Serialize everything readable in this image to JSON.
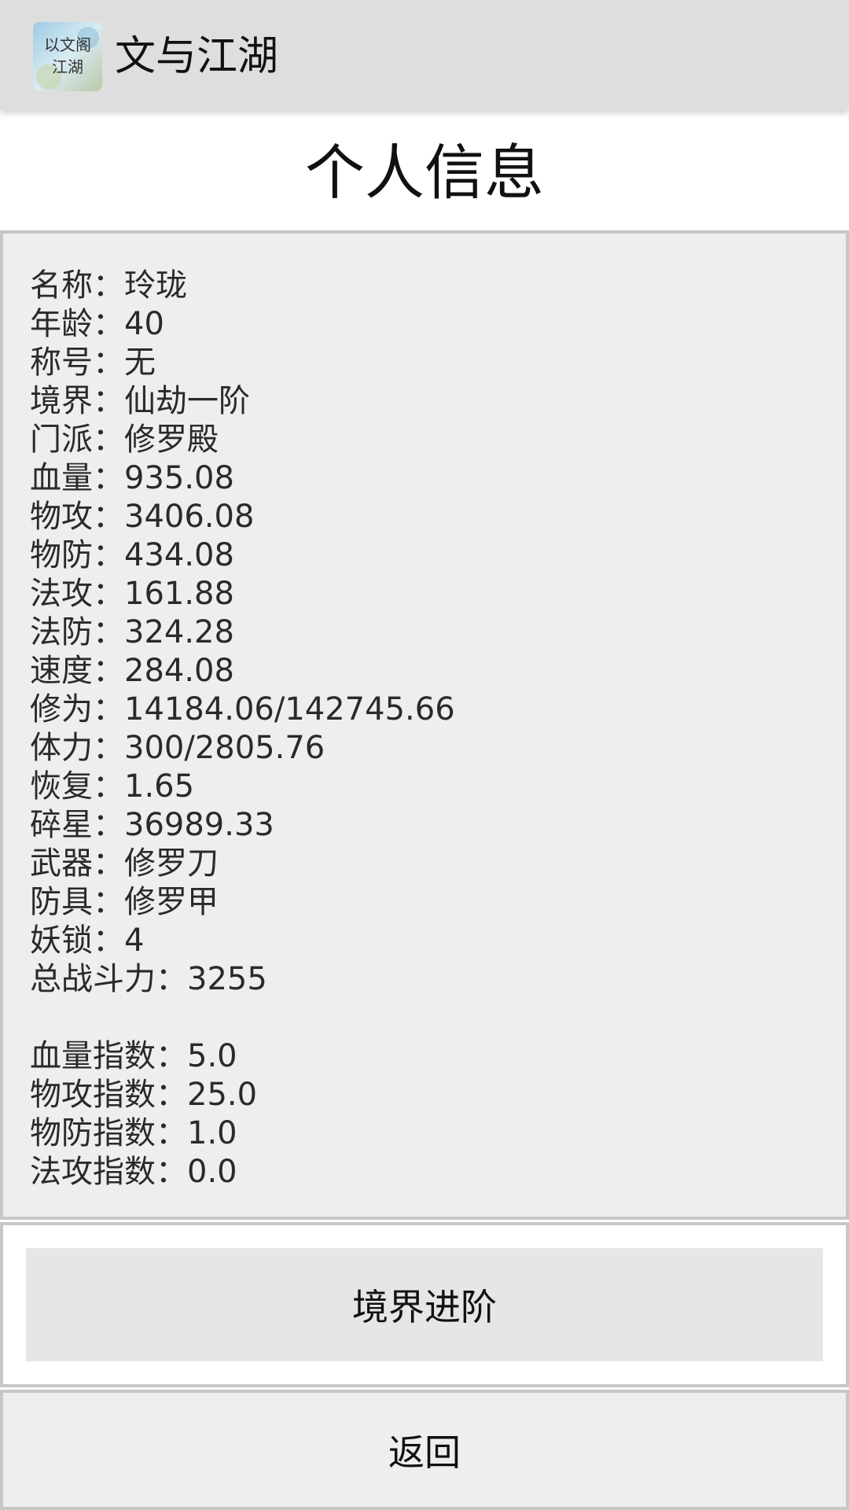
{
  "appbar": {
    "title": "文与江湖",
    "icon": "app-logo-icon"
  },
  "page_title": "个人信息",
  "info_lines": [
    "名称：玲珑",
    "年龄：40",
    "称号：无",
    "境界：仙劫一阶",
    "门派：修罗殿",
    "血量：935.08",
    "物攻：3406.08",
    "物防：434.08",
    "法攻：161.88",
    "法防：324.28",
    "速度：284.08",
    "修为：14184.06/142745.66",
    "体力：300/2805.76",
    "恢复：1.65",
    "碎星：36989.33",
    "武器：修罗刀",
    "防具：修罗甲",
    "妖锁：4",
    "总战斗力：3255"
  ],
  "index_lines": [
    "血量指数：5.0",
    "物攻指数：25.0",
    "物防指数：1.0",
    "法攻指数：0.0"
  ],
  "buttons": {
    "advance_label": "境界进阶",
    "back_label": "返回"
  },
  "colors": {
    "appbar_bg": "#dedede",
    "panel_bg": "#eeeeee",
    "border": "#c7c7c7",
    "button_bg": "#e6e6e6"
  }
}
